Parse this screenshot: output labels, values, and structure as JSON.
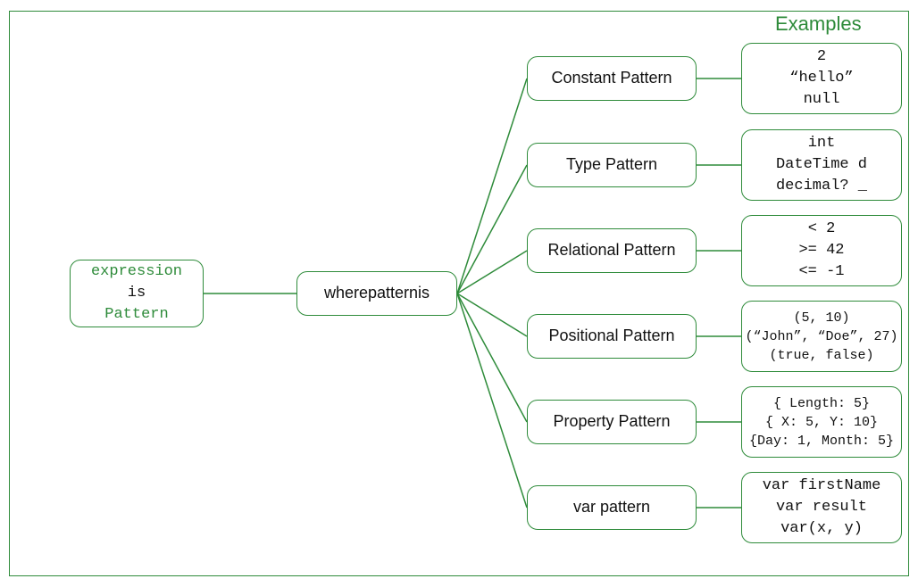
{
  "title": "Examples",
  "root": {
    "line1": "expression",
    "line2": "is",
    "line3": "Pattern"
  },
  "middle": {
    "pre": "where ",
    "em": "pattern",
    "post": " is"
  },
  "patterns": [
    {
      "label": "Constant Pattern",
      "examples": [
        "2",
        "“hello”",
        "null"
      ],
      "small": false
    },
    {
      "label": "Type Pattern",
      "examples": [
        "int",
        "DateTime d",
        "decimal? _"
      ],
      "small": false
    },
    {
      "label": "Relational Pattern",
      "examples": [
        "< 2",
        ">= 42",
        "<= -1"
      ],
      "small": false
    },
    {
      "label": "Positional Pattern",
      "examples": [
        "(5, 10)",
        "(“John”, “Doe”, 27)",
        "(true, false)"
      ],
      "small": true
    },
    {
      "label": "Property Pattern",
      "examples": [
        "{ Length: 5}",
        "{ X: 5, Y: 10}",
        "{Day: 1, Month: 5}"
      ],
      "small": true
    },
    {
      "label": "var pattern",
      "examples": [
        "var firstName",
        "var result",
        "var(x, y)"
      ],
      "small": false
    }
  ],
  "chart_data": {
    "type": "tree",
    "root": "expression is Pattern",
    "child": "where pattern is",
    "branches": [
      {
        "name": "Constant Pattern",
        "examples": [
          "2",
          "\"hello\"",
          "null"
        ]
      },
      {
        "name": "Type Pattern",
        "examples": [
          "int",
          "DateTime d",
          "decimal? _"
        ]
      },
      {
        "name": "Relational Pattern",
        "examples": [
          "< 2",
          ">= 42",
          "<= -1"
        ]
      },
      {
        "name": "Positional Pattern",
        "examples": [
          "(5, 10)",
          "(\"John\", \"Doe\", 27)",
          "(true, false)"
        ]
      },
      {
        "name": "Property Pattern",
        "examples": [
          "{ Length: 5}",
          "{ X: 5, Y: 10}",
          "{Day: 1, Month: 5}"
        ]
      },
      {
        "name": "var pattern",
        "examples": [
          "var firstName",
          "var result",
          "var(x, y)"
        ]
      }
    ]
  }
}
